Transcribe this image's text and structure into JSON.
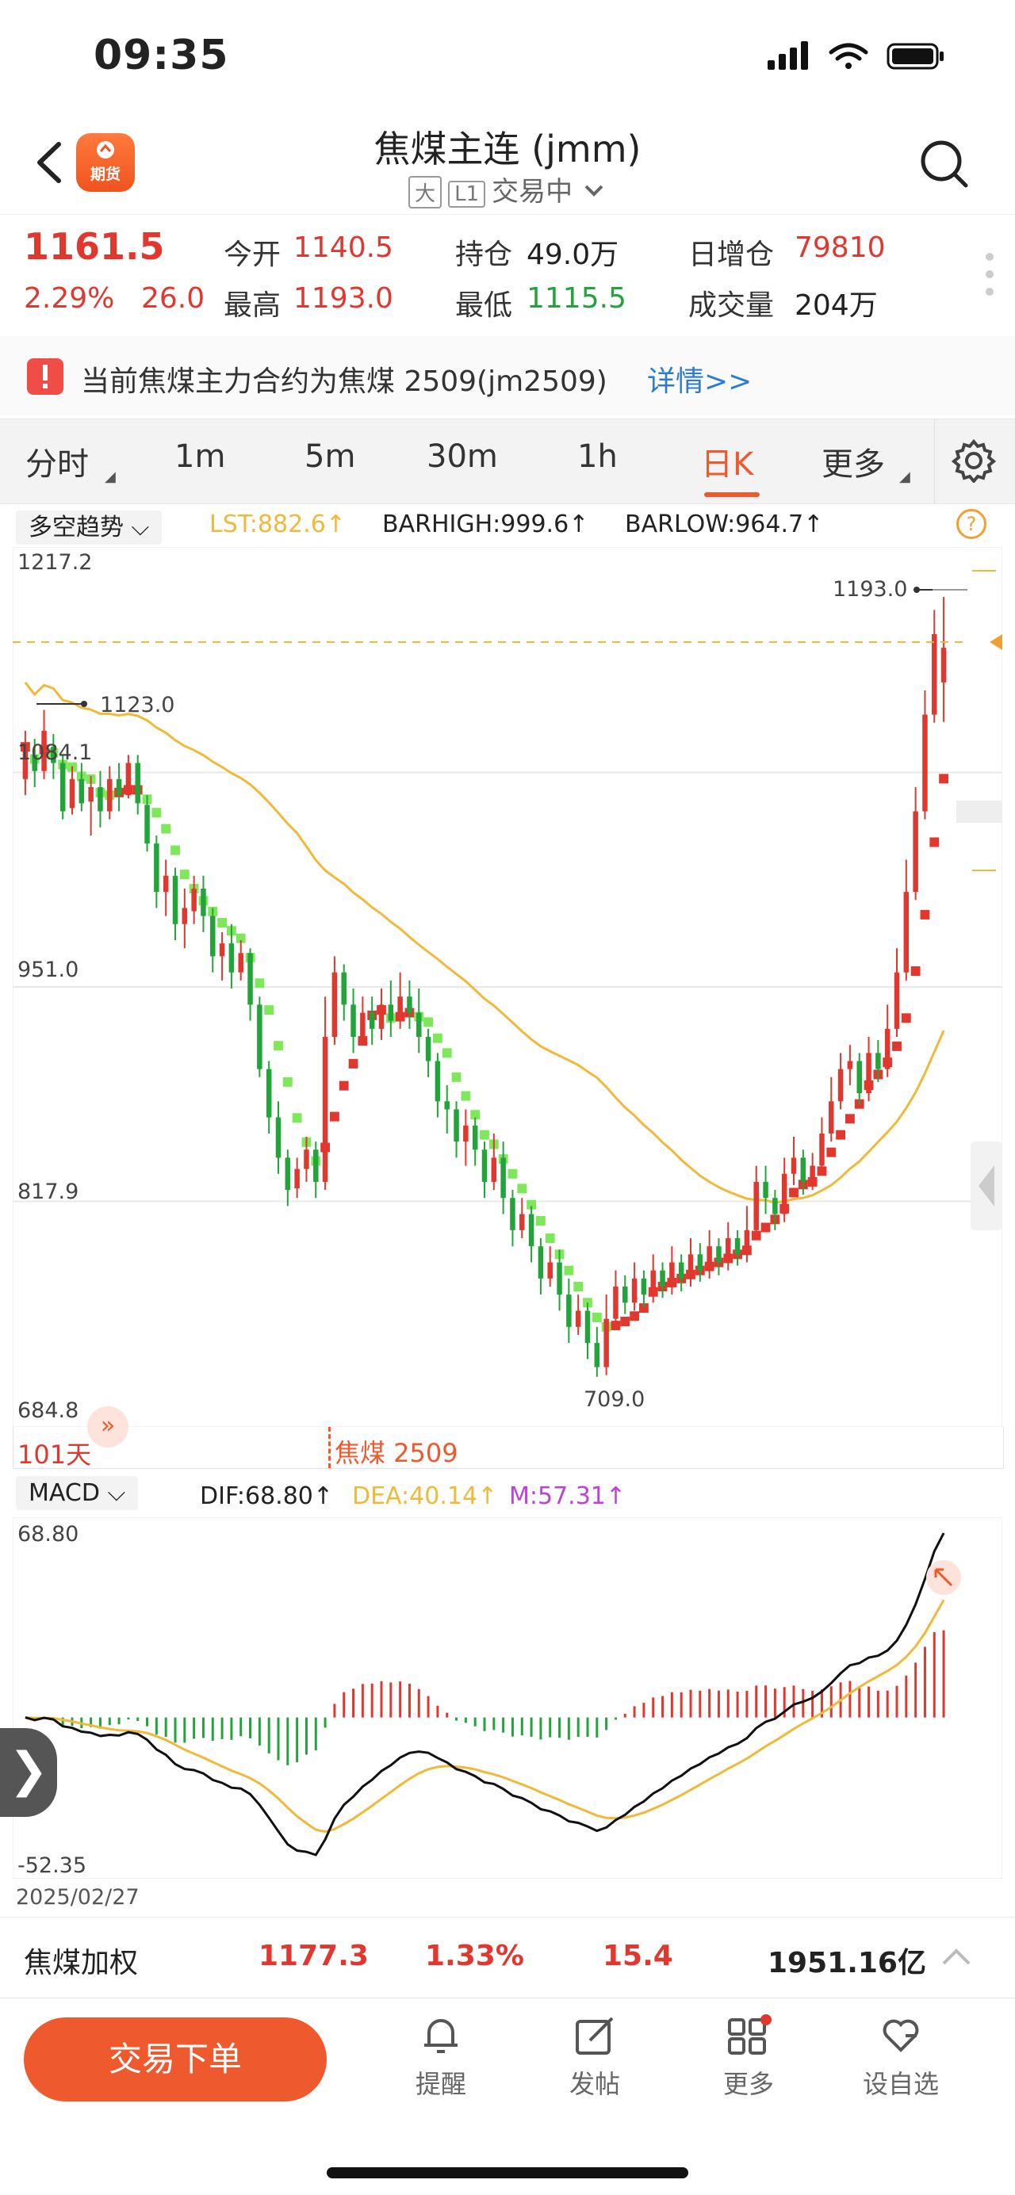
{
  "status_bar": {
    "time": "09:35"
  },
  "header": {
    "logo_text": "期货",
    "title": "焦煤主连 (jmm)",
    "chip_big": "大",
    "chip_l1": "L1",
    "trading_status": "交易中"
  },
  "quote": {
    "last_price": "1161.5",
    "change_pct": "2.29%",
    "change": "26.0",
    "open_label": "今开",
    "open": "1140.5",
    "high_label": "最高",
    "high": "1193.0",
    "position_label": "持仓",
    "position": "49.0万",
    "low_label": "最低",
    "low": "1115.5",
    "daily_add_label": "日增仓",
    "daily_add": "79810",
    "volume_label": "成交量",
    "volume": "204万"
  },
  "notice": {
    "text": "当前焦煤主力合约为焦煤 2509(jm2509)",
    "link": "详情>>"
  },
  "tabs": [
    {
      "label": "分时"
    },
    {
      "label": "1m"
    },
    {
      "label": "5m"
    },
    {
      "label": "30m"
    },
    {
      "label": "1h"
    },
    {
      "label": "日K"
    },
    {
      "label": "更多"
    }
  ],
  "main_indicator": {
    "name": "多空趋势",
    "lst": "LST:882.6↑",
    "barhigh": "BARHIGH:999.6↑",
    "barlow": "BARLOW:964.7↑",
    "help": "?"
  },
  "main_chart": {
    "y_ticks": [
      "1217.2",
      "1084.1",
      "951.0",
      "817.9",
      "684.8"
    ],
    "max_label": "1193.0",
    "min_label": "709.0",
    "left_label": "1123.0",
    "days_label": "101天",
    "contract_label": "焦煤 2509"
  },
  "macd": {
    "name": "MACD",
    "dif": "DIF:68.80↑",
    "dea": "DEA:40.14↑",
    "m": "M:57.31↑",
    "y_top": "68.80",
    "y_bottom": "-52.35",
    "date": "2025/02/27"
  },
  "weighted": {
    "name": "焦煤加权",
    "price": "1177.3",
    "pct": "1.33%",
    "change": "15.4",
    "turnover": "1951.16亿"
  },
  "toolbar": {
    "trade": "交易下单",
    "remind": "提醒",
    "post": "发帖",
    "more": "更多",
    "watch": "设自选"
  },
  "colors": {
    "up": "#e0382f",
    "down": "#23a43a",
    "accent": "#ee5a2d",
    "trend_up": "#e0382f",
    "trend_down": "#7fe85a",
    "ma": "#f0b93a"
  },
  "chart_data": {
    "type": "candlestick",
    "ylim": [
      684.8,
      1217.2
    ],
    "candles": [
      [
        1080,
        1100,
        1070,
        1110
      ],
      [
        1095,
        1085,
        1075,
        1105
      ],
      [
        1085,
        1110,
        1080,
        1123
      ],
      [
        1100,
        1090,
        1080,
        1108
      ],
      [
        1090,
        1060,
        1055,
        1095
      ],
      [
        1062,
        1080,
        1058,
        1088
      ],
      [
        1080,
        1065,
        1060,
        1090
      ],
      [
        1066,
        1075,
        1045,
        1082
      ],
      [
        1075,
        1060,
        1050,
        1085
      ],
      [
        1060,
        1080,
        1055,
        1088
      ],
      [
        1080,
        1070,
        1060,
        1090
      ],
      [
        1070,
        1090,
        1068,
        1095
      ],
      [
        1090,
        1065,
        1058,
        1095
      ],
      [
        1064,
        1040,
        1035,
        1070
      ],
      [
        1040,
        1010,
        1000,
        1045
      ],
      [
        1010,
        1020,
        995,
        1030
      ],
      [
        1020,
        990,
        980,
        1025
      ],
      [
        990,
        1000,
        975,
        1012
      ],
      [
        998,
        1012,
        990,
        1020
      ],
      [
        1012,
        995,
        985,
        1020
      ],
      [
        995,
        970,
        960,
        1000
      ],
      [
        970,
        978,
        955,
        985
      ],
      [
        978,
        960,
        950,
        990
      ],
      [
        960,
        972,
        955,
        980
      ],
      [
        972,
        940,
        930,
        975
      ],
      [
        940,
        900,
        895,
        945
      ],
      [
        900,
        870,
        860,
        905
      ],
      [
        870,
        845,
        835,
        880
      ],
      [
        845,
        825,
        815,
        850
      ],
      [
        826,
        838,
        820,
        845
      ],
      [
        838,
        850,
        830,
        858
      ],
      [
        850,
        830,
        820,
        855
      ],
      [
        830,
        920,
        825,
        945
      ],
      [
        920,
        960,
        915,
        970
      ],
      [
        960,
        940,
        930,
        965
      ],
      [
        940,
        920,
        910,
        950
      ],
      [
        920,
        935,
        915,
        945
      ],
      [
        935,
        925,
        915,
        945
      ],
      [
        925,
        940,
        918,
        950
      ],
      [
        940,
        930,
        920,
        955
      ],
      [
        930,
        945,
        925,
        960
      ],
      [
        945,
        935,
        925,
        955
      ],
      [
        935,
        920,
        910,
        950
      ],
      [
        920,
        905,
        895,
        925
      ],
      [
        905,
        880,
        870,
        910
      ],
      [
        880,
        875,
        860,
        890
      ],
      [
        875,
        855,
        845,
        880
      ],
      [
        855,
        865,
        840,
        875
      ],
      [
        865,
        850,
        840,
        870
      ],
      [
        850,
        830,
        820,
        855
      ],
      [
        830,
        845,
        825,
        860
      ],
      [
        845,
        820,
        810,
        855
      ],
      [
        820,
        800,
        790,
        825
      ],
      [
        800,
        810,
        795,
        820
      ],
      [
        810,
        790,
        780,
        815
      ],
      [
        790,
        770,
        760,
        795
      ],
      [
        770,
        780,
        765,
        790
      ],
      [
        780,
        760,
        750,
        788
      ],
      [
        760,
        740,
        730,
        770
      ],
      [
        740,
        750,
        735,
        760
      ],
      [
        750,
        730,
        720,
        755
      ],
      [
        730,
        715,
        709,
        740
      ],
      [
        715,
        745,
        710,
        760
      ],
      [
        745,
        765,
        740,
        775
      ],
      [
        765,
        755,
        748,
        772
      ],
      [
        755,
        770,
        750,
        780
      ],
      [
        770,
        760,
        752,
        775
      ],
      [
        760,
        775,
        755,
        785
      ],
      [
        775,
        765,
        758,
        780
      ],
      [
        765,
        780,
        760,
        790
      ],
      [
        780,
        770,
        762,
        785
      ],
      [
        770,
        785,
        765,
        795
      ],
      [
        785,
        775,
        768,
        792
      ],
      [
        775,
        790,
        770,
        800
      ],
      [
        790,
        780,
        772,
        795
      ],
      [
        780,
        795,
        775,
        805
      ],
      [
        795,
        785,
        778,
        800
      ],
      [
        785,
        800,
        780,
        815
      ],
      [
        800,
        830,
        795,
        840
      ],
      [
        830,
        820,
        810,
        840
      ],
      [
        820,
        810,
        800,
        825
      ],
      [
        810,
        835,
        805,
        845
      ],
      [
        835,
        845,
        828,
        858
      ],
      [
        845,
        830,
        822,
        850
      ],
      [
        830,
        840,
        825,
        848
      ],
      [
        840,
        860,
        835,
        870
      ],
      [
        860,
        880,
        855,
        895
      ],
      [
        880,
        900,
        875,
        910
      ],
      [
        900,
        905,
        890,
        915
      ],
      [
        905,
        885,
        878,
        910
      ],
      [
        885,
        910,
        880,
        920
      ],
      [
        910,
        900,
        892,
        918
      ],
      [
        900,
        925,
        895,
        940
      ],
      [
        925,
        960,
        920,
        975
      ],
      [
        960,
        1010,
        955,
        1030
      ],
      [
        1010,
        1060,
        1005,
        1075
      ],
      [
        1060,
        1120,
        1055,
        1135
      ],
      [
        1120,
        1170,
        1115,
        1185
      ],
      [
        1140,
        1161.5,
        1115.5,
        1193
      ]
    ],
    "macd_hist_note": "histogram derived from DIF-DEA"
  }
}
